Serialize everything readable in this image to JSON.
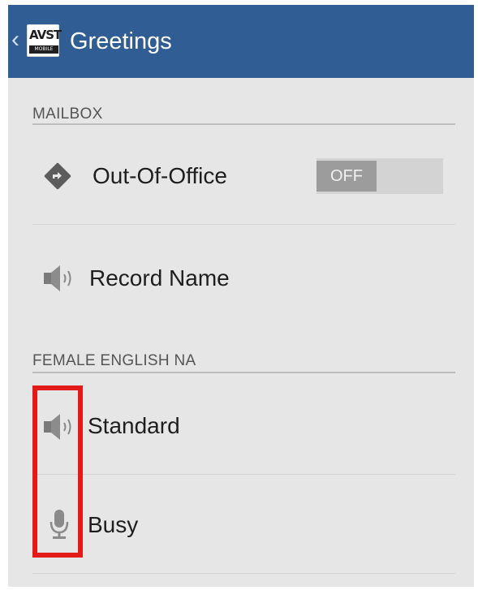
{
  "header": {
    "title": "Greetings",
    "logo_top": "AVST",
    "logo_bottom": "MOBILE"
  },
  "sections": [
    {
      "label": "MAILBOX"
    },
    {
      "label": "FEMALE ENGLISH NA"
    }
  ],
  "mailbox_items": [
    {
      "label": "Out-Of-Office",
      "icon": "directions-icon",
      "toggle": "OFF"
    },
    {
      "label": "Record Name",
      "icon": "speaker-icon"
    }
  ],
  "greeting_items": [
    {
      "label": "Standard",
      "icon": "speaker-icon"
    },
    {
      "label": "Busy",
      "icon": "microphone-icon"
    }
  ],
  "colors": {
    "appbar": "#305e94",
    "background": "#e6e6e6",
    "highlight": "#e21a1a"
  }
}
